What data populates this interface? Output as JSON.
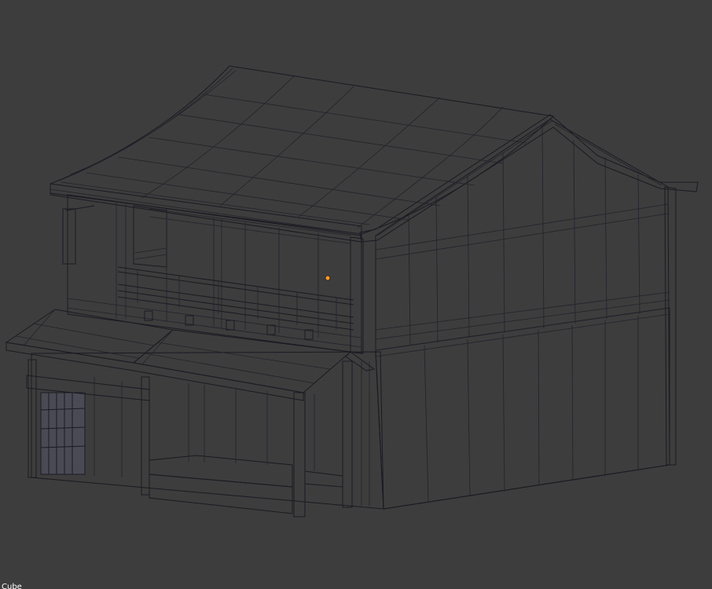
{
  "viewport": {
    "background_color": "#3d3d3d",
    "object_label": "Cube"
  },
  "model": {
    "name": "japanese-two-storey-house",
    "shading": "solid",
    "colors": {
      "roof_top": "#9c9db6",
      "roof_edge": "#8e8fa9",
      "front_wall": "#9a9bb2",
      "side_wall_dark": "#5f6079",
      "side_wall": "#6b6c88",
      "awning": "#a3a4bb",
      "wireframe": "#1a1a22"
    },
    "origin_marker_color": "#f59a2b"
  }
}
